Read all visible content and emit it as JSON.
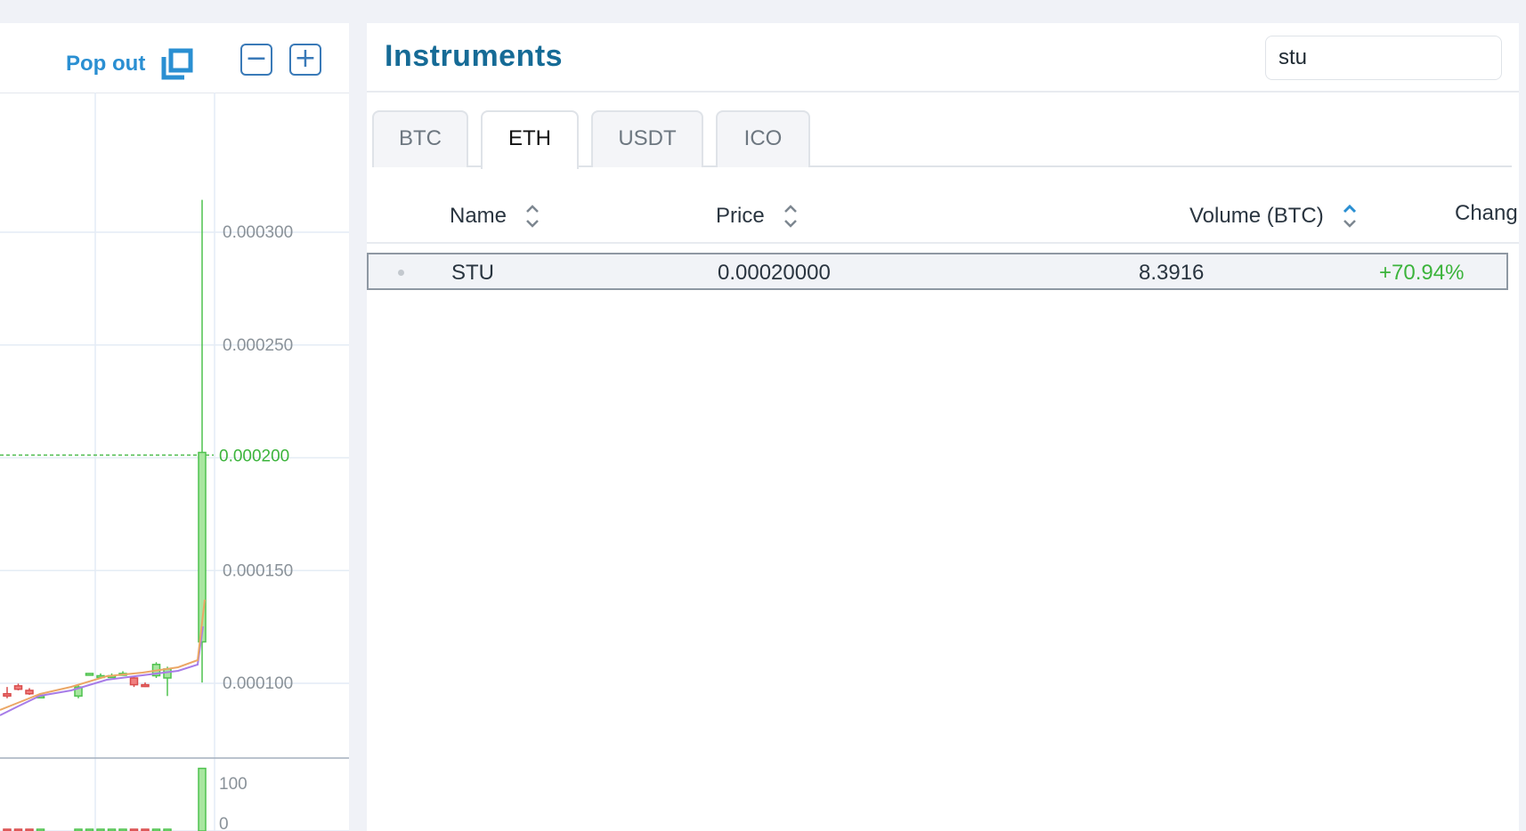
{
  "chart_panel": {
    "pop_out_label": "Pop out",
    "zoom_out_symbol": "−",
    "zoom_in_symbol": "+",
    "icons": [
      "pop-out-icon",
      "zoom-out-icon",
      "zoom-in-icon"
    ]
  },
  "chart_data": {
    "type": "candlestick",
    "price_ticks": [
      "0.000300",
      "0.000250",
      "0.000200",
      "0.000150",
      "0.000100"
    ],
    "current_price_label": "0.000200",
    "volume_ticks": [
      "100",
      "0"
    ],
    "candles": [
      {
        "o": 9.3e-05,
        "h": 9.6e-05,
        "l": 9.1e-05,
        "c": 9.2e-05,
        "color": "red"
      },
      {
        "o": 9.65e-05,
        "h": 9.75e-05,
        "l": 9.45e-05,
        "c": 9.5e-05,
        "color": "red"
      },
      {
        "o": 9.45e-05,
        "h": 9.55e-05,
        "l": 9.25e-05,
        "c": 9.3e-05,
        "color": "red"
      },
      {
        "o": 9.2e-05,
        "h": 9.3e-05,
        "l": 9.1e-05,
        "c": 9.2e-05,
        "color": "green"
      },
      {
        "o": 9.2e-05,
        "h": 9.7e-05,
        "l": 9.1e-05,
        "c": 9.6e-05,
        "color": "green"
      },
      {
        "o": 0.000102,
        "h": 0.000102,
        "l": 0.000102,
        "c": 0.000102,
        "color": "green"
      },
      {
        "o": 0.000101,
        "h": 0.000102,
        "l": 0.0001,
        "c": 0.000101,
        "color": "green"
      },
      {
        "o": 0.000101,
        "h": 0.000102,
        "l": 0.0001,
        "c": 0.000101,
        "color": "green"
      },
      {
        "o": 0.000102,
        "h": 0.000103,
        "l": 0.000101,
        "c": 0.000102,
        "color": "green"
      },
      {
        "o": 0.0001,
        "h": 0.000101,
        "l": 9.6e-05,
        "c": 9.7e-05,
        "color": "red"
      },
      {
        "o": 9.7e-05,
        "h": 9.8e-05,
        "l": 9.6e-05,
        "c": 9.7e-05,
        "color": "red"
      },
      {
        "o": 0.000101,
        "h": 0.000107,
        "l": 0.0001,
        "c": 0.000106,
        "color": "green"
      },
      {
        "o": 0.0001,
        "h": 0.000105,
        "l": 9.2e-05,
        "c": 0.000104,
        "color": "green"
      },
      {
        "o": 0.000116,
        "h": 0.000312,
        "l": 9.8e-05,
        "c": 0.0002,
        "color": "green"
      }
    ],
    "volumes": [
      1,
      1,
      1,
      2,
      2,
      1,
      1,
      1,
      1,
      1,
      1,
      2,
      2,
      128
    ]
  },
  "instruments": {
    "title": "Instruments",
    "search_value": "stu",
    "tabs": [
      {
        "label": "BTC"
      },
      {
        "label": "ETH"
      },
      {
        "label": "USDT"
      },
      {
        "label": "ICO"
      }
    ],
    "active_tab": "ETH",
    "columns": {
      "name": "Name",
      "price": "Price",
      "volume": "Volume (BTC)",
      "change": "Chang"
    },
    "rows": [
      {
        "name": "STU",
        "price": "0.00020000",
        "volume": "8.3916",
        "change": "+70.94%"
      }
    ],
    "colors": {
      "accent": "#166b96",
      "link": "#2a8fd2",
      "positive": "#3cb43c",
      "negative": "#e05555"
    }
  }
}
